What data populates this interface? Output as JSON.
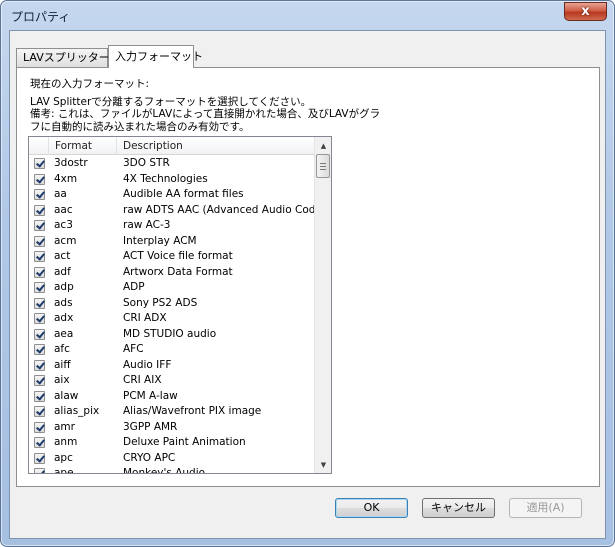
{
  "window": {
    "title": "プロパティ",
    "close_label": "x"
  },
  "tabs": [
    {
      "label": "LAVスプリッター"
    },
    {
      "label": "入力フォーマット"
    }
  ],
  "description": {
    "line1": "現在の入力フォーマット:",
    "line2": "LAV Splitterで分離するフォーマットを選択してください。",
    "line3": "備考: これは、ファイルがLAVによって直接開かれた場合、及びLAVがグラ",
    "line4": "フに自動的に読み込まれた場合のみ有効です。"
  },
  "list": {
    "columns": {
      "format": "Format",
      "description": "Description"
    },
    "rows": [
      {
        "format": "3dostr",
        "description": "3DO STR",
        "checked": true
      },
      {
        "format": "4xm",
        "description": "4X Technologies",
        "checked": true
      },
      {
        "format": "aa",
        "description": "Audible AA format files",
        "checked": true
      },
      {
        "format": "aac",
        "description": "raw ADTS AAC (Advanced Audio Coding)",
        "checked": true
      },
      {
        "format": "ac3",
        "description": "raw AC-3",
        "checked": true
      },
      {
        "format": "acm",
        "description": "Interplay ACM",
        "checked": true
      },
      {
        "format": "act",
        "description": "ACT Voice file format",
        "checked": true
      },
      {
        "format": "adf",
        "description": "Artworx Data Format",
        "checked": true
      },
      {
        "format": "adp",
        "description": "ADP",
        "checked": true
      },
      {
        "format": "ads",
        "description": "Sony PS2 ADS",
        "checked": true
      },
      {
        "format": "adx",
        "description": "CRI ADX",
        "checked": true
      },
      {
        "format": "aea",
        "description": "MD STUDIO audio",
        "checked": true
      },
      {
        "format": "afc",
        "description": "AFC",
        "checked": true
      },
      {
        "format": "aiff",
        "description": "Audio IFF",
        "checked": true
      },
      {
        "format": "aix",
        "description": "CRI AIX",
        "checked": true
      },
      {
        "format": "alaw",
        "description": "PCM A-law",
        "checked": true
      },
      {
        "format": "alias_pix",
        "description": "Alias/Wavefront PIX image",
        "checked": true
      },
      {
        "format": "amr",
        "description": "3GPP AMR",
        "checked": true
      },
      {
        "format": "anm",
        "description": "Deluxe Paint Animation",
        "checked": true
      },
      {
        "format": "apc",
        "description": "CRYO APC",
        "checked": true
      },
      {
        "format": "ape",
        "description": "Monkey's Audio",
        "checked": true
      }
    ]
  },
  "buttons": {
    "ok": "OK",
    "cancel": "キャンセル",
    "apply": "適用(A)"
  }
}
